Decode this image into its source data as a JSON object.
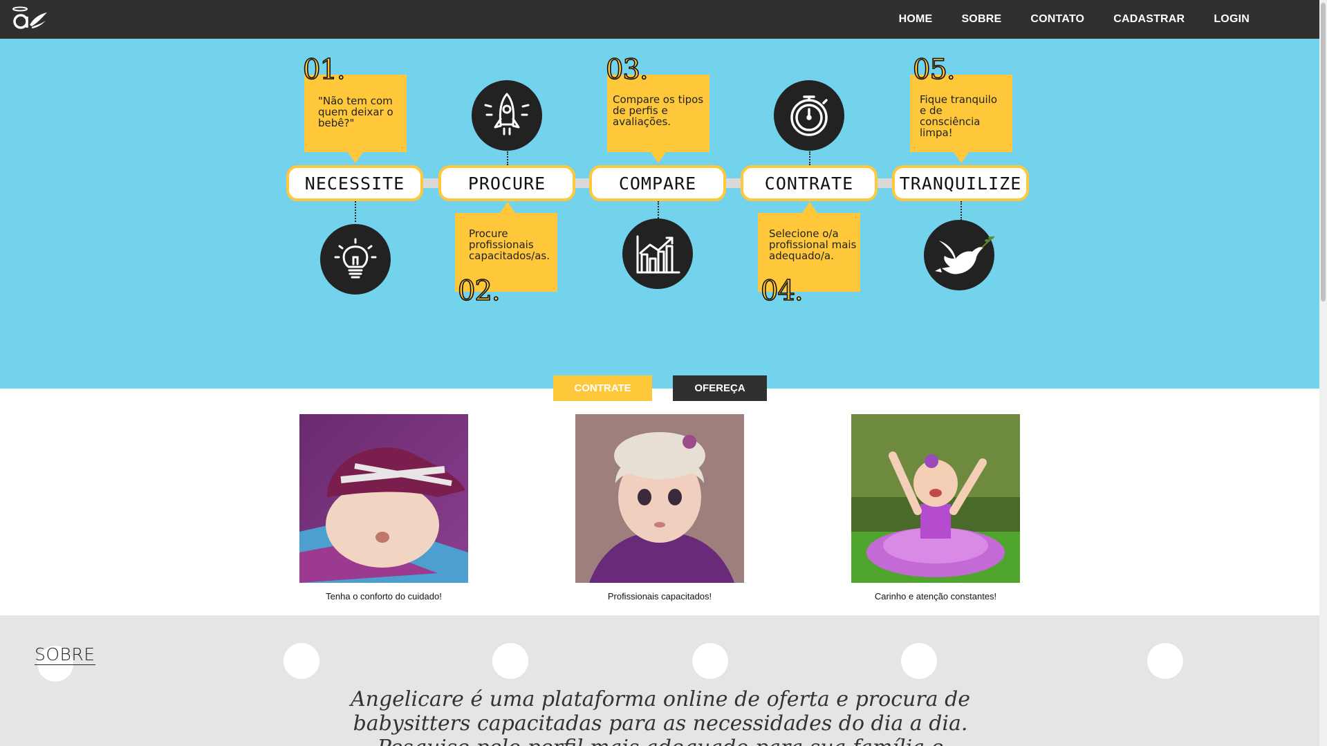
{
  "nav": {
    "logo_alt": "Angelicare logo",
    "links": [
      "HOME",
      "SOBRE",
      "CONTATO",
      "CADASTRAR",
      "LOGIN"
    ]
  },
  "steps": [
    {
      "number": "01.",
      "label": "NECESSITE",
      "note": "\"Não tem com quem deixar o bebê?\"",
      "icon": "lightbulb-icon"
    },
    {
      "number": "02.",
      "label": "PROCURE",
      "note": "Procure profissionais capacitados/as.",
      "icon": "rocket-icon"
    },
    {
      "number": "03.",
      "label": "COMPARE",
      "note": "Compare os tipos de perfis e avaliações.",
      "icon": "bar-chart-icon"
    },
    {
      "number": "04.",
      "label": "CONTRATE",
      "note": "Selecione o/a profissional mais adequado/a.",
      "icon": "stopwatch-icon"
    },
    {
      "number": "05.",
      "label": "TRANQUILIZE",
      "note": "Fique tranquilo e de consciência limpa!",
      "icon": "dove-icon"
    }
  ],
  "actions": {
    "hire": "CONTRATE",
    "offer": "OFEREÇA"
  },
  "gallery": [
    {
      "caption": "Tenha o conforto do cuidado!",
      "image": "sleeping-baby-photo"
    },
    {
      "caption": "Profissionais capacitados!",
      "image": "baby-girl-hat-photo"
    },
    {
      "caption": "Carinho e atenção constantes!",
      "image": "happy-baby-tutu-photo"
    }
  ],
  "sobre": {
    "title": "SOBRE",
    "text": "Angelicare é uma plataforma online de oferta e procura de babysitters capacitadas para as necessidades do dia a dia. Pesquise pelo perfil mais adequado para sua família e"
  },
  "colors": {
    "nav_bg": "#303030",
    "hero_bg": "#73d3ec",
    "accent_yellow": "#ffc83b",
    "sobre_bg": "#e5e5e5"
  }
}
